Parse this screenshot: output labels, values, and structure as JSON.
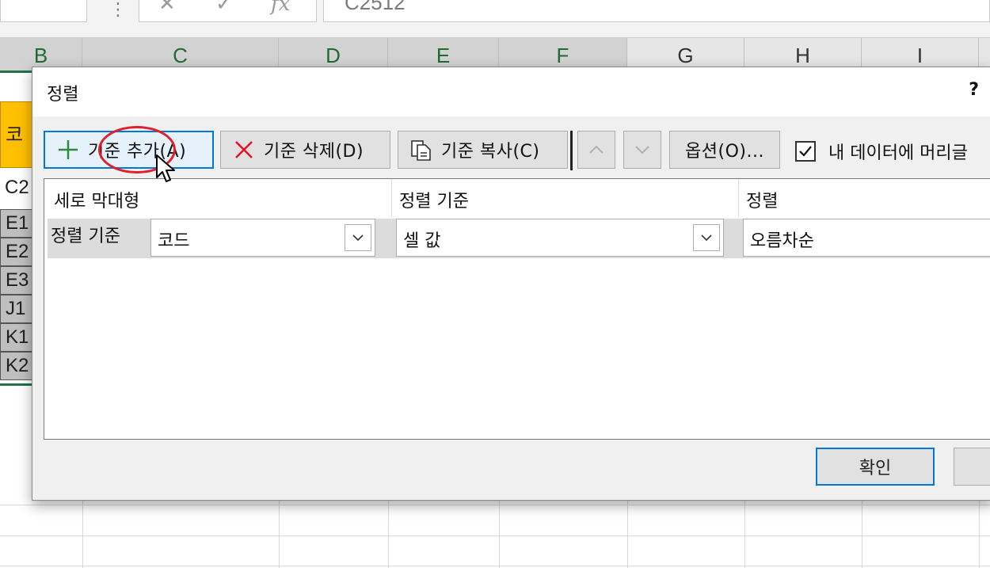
{
  "formula_bar": {
    "separator": "⋮",
    "cancel_icon": "✕",
    "enter_icon": "✓",
    "fx_label": "fx",
    "value": "C2512"
  },
  "columns": [
    "B",
    "C",
    "D",
    "E",
    "F",
    "G",
    "H",
    "I"
  ],
  "left_cells": [
    "",
    "코",
    "C2",
    "E1",
    "E2",
    "E3",
    "J1",
    "K1",
    "K2"
  ],
  "dialog": {
    "title": "정렬",
    "help": "?",
    "toolbar": {
      "add_level": "기준 추가(A)",
      "delete_level": "기준 삭제(D)",
      "copy_level": "기준 복사(C)",
      "move_up": "^",
      "move_down": "v",
      "options": "옵션(O)...",
      "header_checkbox_label": "내 데이터에 머리글",
      "header_checkbox_checked": true
    },
    "list": {
      "headers": [
        "세로 막대형",
        "정렬 기준",
        "정렬"
      ],
      "rows": [
        {
          "label": "정렬 기준",
          "column": "코드",
          "sort_on": "셀 값",
          "order": "오름차순"
        }
      ]
    },
    "ok_label": "확인",
    "cancel_label": ""
  },
  "colors": {
    "accent": "#0078d7",
    "header_fill": "#ffc000",
    "highlight_ring": "#e0202a",
    "add_icon": "#2e8b3a",
    "delete_icon": "#e81123"
  }
}
